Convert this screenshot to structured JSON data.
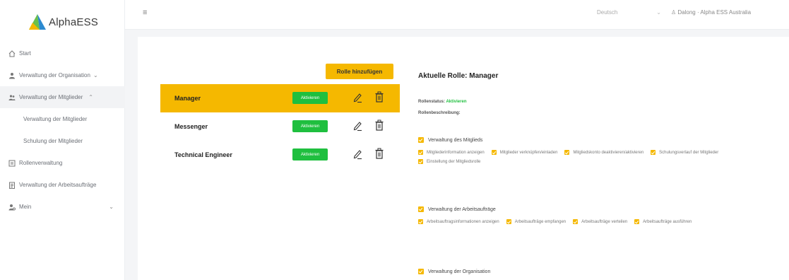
{
  "brand": {
    "name": "AlphaESS"
  },
  "sidebar": {
    "items": [
      {
        "label": "Start",
        "icon": "home-icon"
      },
      {
        "label": "Verwaltung der Organisation",
        "icon": "person-icon",
        "expanded": false
      },
      {
        "label": "Verwaltung der Mitglieder",
        "icon": "people-icon",
        "expanded": true
      },
      {
        "label": "Verwaltung der Mitglieder",
        "sub": true
      },
      {
        "label": "Schulung der Mitglieder",
        "sub": true
      },
      {
        "label": "Rollenverwaltung",
        "icon": "roles-icon"
      },
      {
        "label": "Verwaltung der Arbeitsaufträge",
        "icon": "clipboard-icon"
      },
      {
        "label": "Mein",
        "icon": "user-settings-icon",
        "expanded": false
      }
    ]
  },
  "topbar": {
    "language": "Deutsch",
    "user": "Dalong · Alpha ESS Australia"
  },
  "roles": {
    "add_label": "Rolle hinzufügen",
    "activate_label": "Aktivieren",
    "list": [
      {
        "name": "Manager",
        "active": true
      },
      {
        "name": "Messenger",
        "active": false
      },
      {
        "name": "Technical Engineer",
        "active": false
      }
    ]
  },
  "detail": {
    "title": "Aktuelle Rolle: Manager",
    "status_label": "Rollenstatus:",
    "status_value": "Aktivieren",
    "description_label": "Rollenbeschreibung:",
    "groups": [
      {
        "title": "Verwaltung des Mitglieds",
        "perms": [
          "Mitgliederinformation anzeigen",
          "Mitglieder verknüpfen/einladen",
          "Mitgliedskonto deaktivieren/aktivieren",
          "Schulungsverlauf der Mitglieder",
          "Einstellung der Mitgliedsrolle"
        ]
      },
      {
        "title": "Verwaltung der Arbeitsaufträge",
        "perms": [
          "Arbeitsauftragsinformationen anzeigen",
          "Arbeitsaufträge empfangen",
          "Arbeitsaufträge verteilen",
          "Arbeitsaufträge ausführen"
        ]
      },
      {
        "title": "Verwaltung der Organisation",
        "perms": []
      }
    ]
  },
  "colors": {
    "accent": "#f5b800",
    "success": "#1fbf3f"
  }
}
